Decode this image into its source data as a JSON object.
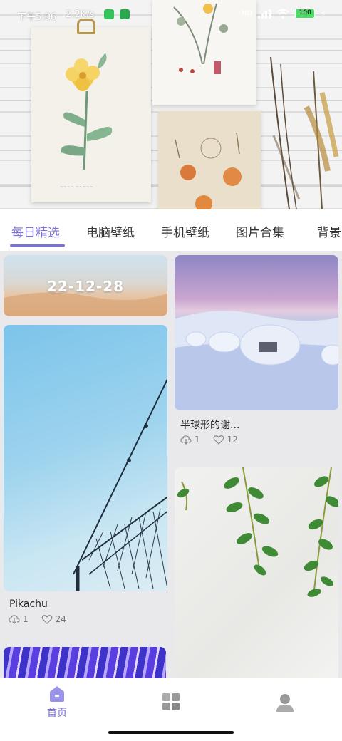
{
  "status_bar": {
    "time": "下午5:06",
    "speed": "2.2K/s",
    "network": "HD",
    "battery": "100"
  },
  "tabs": [
    {
      "label": "每日精选",
      "active": true
    },
    {
      "label": "电脑壁纸",
      "active": false
    },
    {
      "label": "手机壁纸",
      "active": false
    },
    {
      "label": "图片合集",
      "active": false
    },
    {
      "label": "背景",
      "active": false
    }
  ],
  "feed": {
    "date_tile": "22-12-28",
    "items": [
      {
        "title": "半球形的谢...",
        "downloads": "1",
        "likes": "12"
      },
      {
        "title": "Pikachu",
        "downloads": "1",
        "likes": "24"
      }
    ]
  },
  "bottom_nav": {
    "home_label": "首页"
  },
  "colors": {
    "accent": "#7b72d8"
  }
}
